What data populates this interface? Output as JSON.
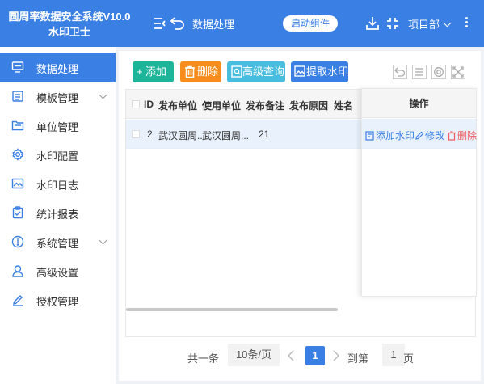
{
  "header": {
    "brand_line1": "圆周率数据安全系统V10.0",
    "brand_line2": "水印卫士",
    "page_title": "数据处理",
    "start_button": "启动组件",
    "project_label": "项目部",
    "accent_color": "#3a7fe4"
  },
  "sidebar": {
    "items": [
      {
        "label": "数据处理",
        "icon": "monitor-icon",
        "active": true
      },
      {
        "label": "模板管理",
        "icon": "template-icon",
        "has_children": true
      },
      {
        "label": "单位管理",
        "icon": "folder-icon"
      },
      {
        "label": "水印配置",
        "icon": "gear-icon"
      },
      {
        "label": "水印日志",
        "icon": "image-icon"
      },
      {
        "label": "统计报表",
        "icon": "clipboard-icon"
      },
      {
        "label": "系统管理",
        "icon": "info-icon",
        "has_children": true
      },
      {
        "label": "高级设置",
        "icon": "user-icon"
      },
      {
        "label": "授权管理",
        "icon": "pen-icon"
      }
    ]
  },
  "toolbar": {
    "add_label": "添加",
    "delete_label": "删除",
    "advanced_label": "高级查询",
    "extract_label": "提取水印",
    "tool_icons": [
      "undo-icon",
      "list-icon",
      "settings-icon",
      "fullscreen-icon"
    ]
  },
  "table": {
    "columns": [
      "ID",
      "发布单位",
      "使用单位",
      "发布备注",
      "发布原因",
      "姓名"
    ],
    "rows": [
      {
        "id": "2",
        "publisher": "武汉圆周...",
        "user_unit": "武汉圆周...",
        "note": "21"
      }
    ],
    "ops_header": "操作",
    "ops": {
      "add_watermark": "添加水印",
      "edit": "修改",
      "delete": "删除"
    }
  },
  "pagination": {
    "total_text": "共一条",
    "page_size": "10条/页",
    "current_page": "1",
    "goto_label": "到第",
    "goto_value": "1",
    "page_suffix": "页"
  }
}
